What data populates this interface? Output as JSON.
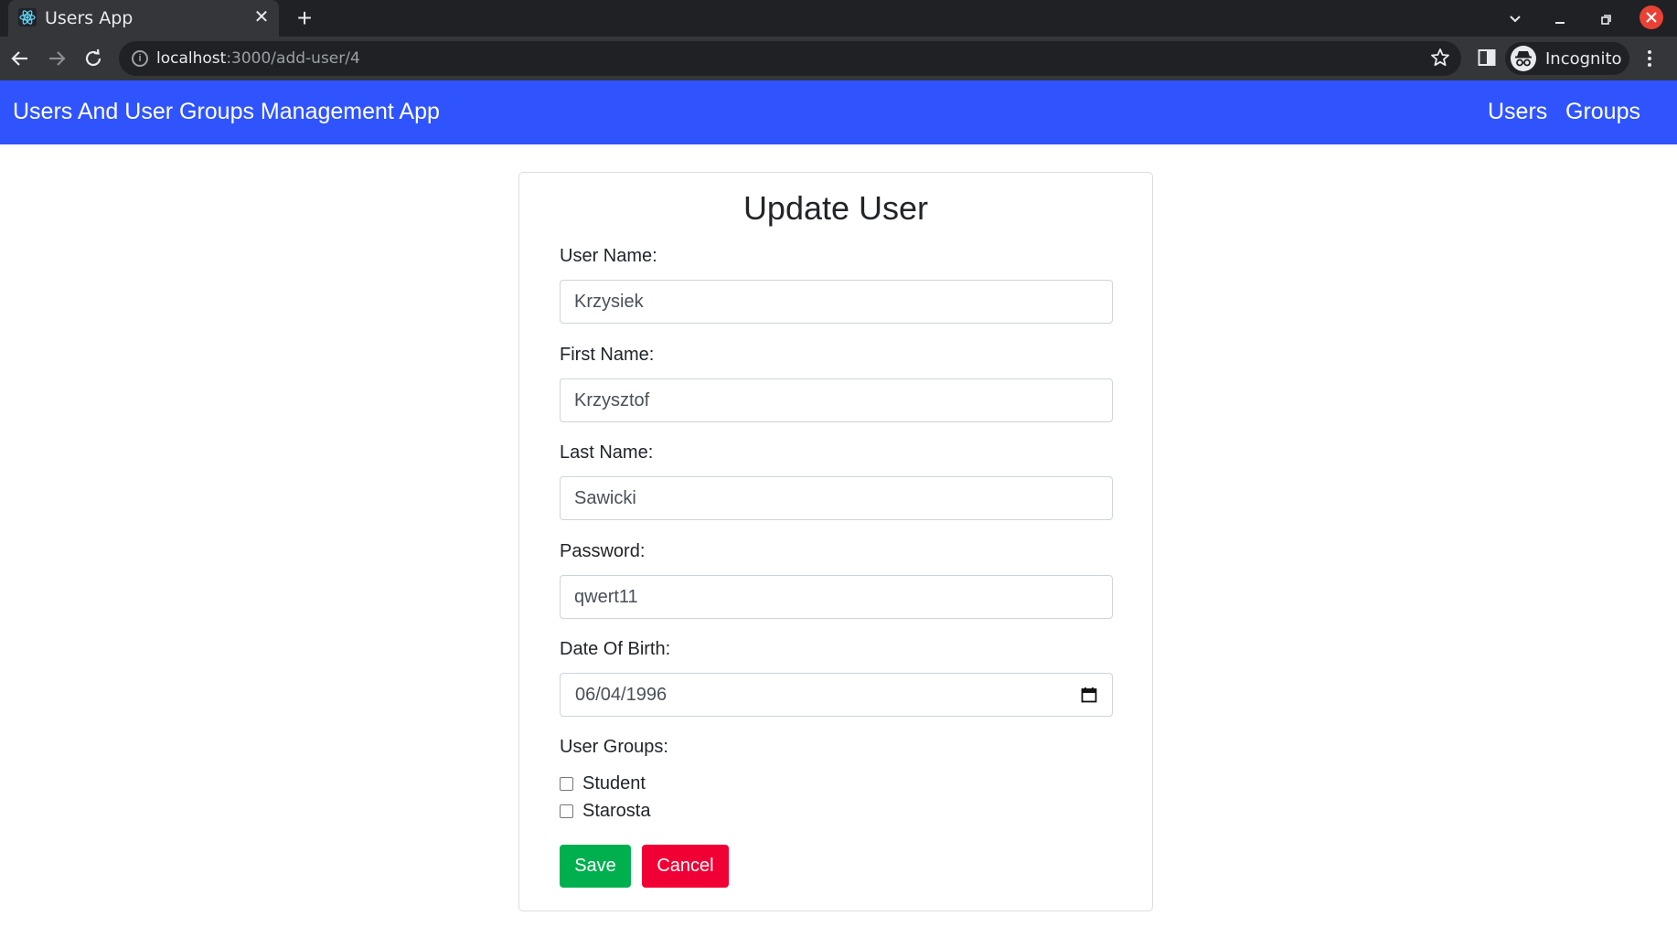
{
  "browser": {
    "tab_title": "Users App",
    "tab_close": "✕",
    "new_tab": "+",
    "url_host": "localhost",
    "url_path": ":3000/add-user/4",
    "profile_label": "Incognito"
  },
  "navbar": {
    "brand": "Users And User Groups Management App",
    "links": [
      "Users",
      "Groups"
    ],
    "background_color": "#2f54fe"
  },
  "form": {
    "title": "Update User",
    "fields": [
      {
        "label": "User Name:",
        "value": "Krzysiek"
      },
      {
        "label": "First Name:",
        "value": "Krzysztof"
      },
      {
        "label": "Last Name:",
        "value": "Sawicki"
      },
      {
        "label": "Password:",
        "value": "qwert11"
      },
      {
        "label": "Date Of Birth:",
        "value": "06/04/1996"
      }
    ],
    "groups_label": "User Groups:",
    "groups": [
      {
        "label": "Student",
        "checked": false
      },
      {
        "label": "Starosta",
        "checked": false
      }
    ],
    "save_label": "Save",
    "cancel_label": "Cancel",
    "save_color": "#00b04f",
    "cancel_color": "#f10035"
  }
}
